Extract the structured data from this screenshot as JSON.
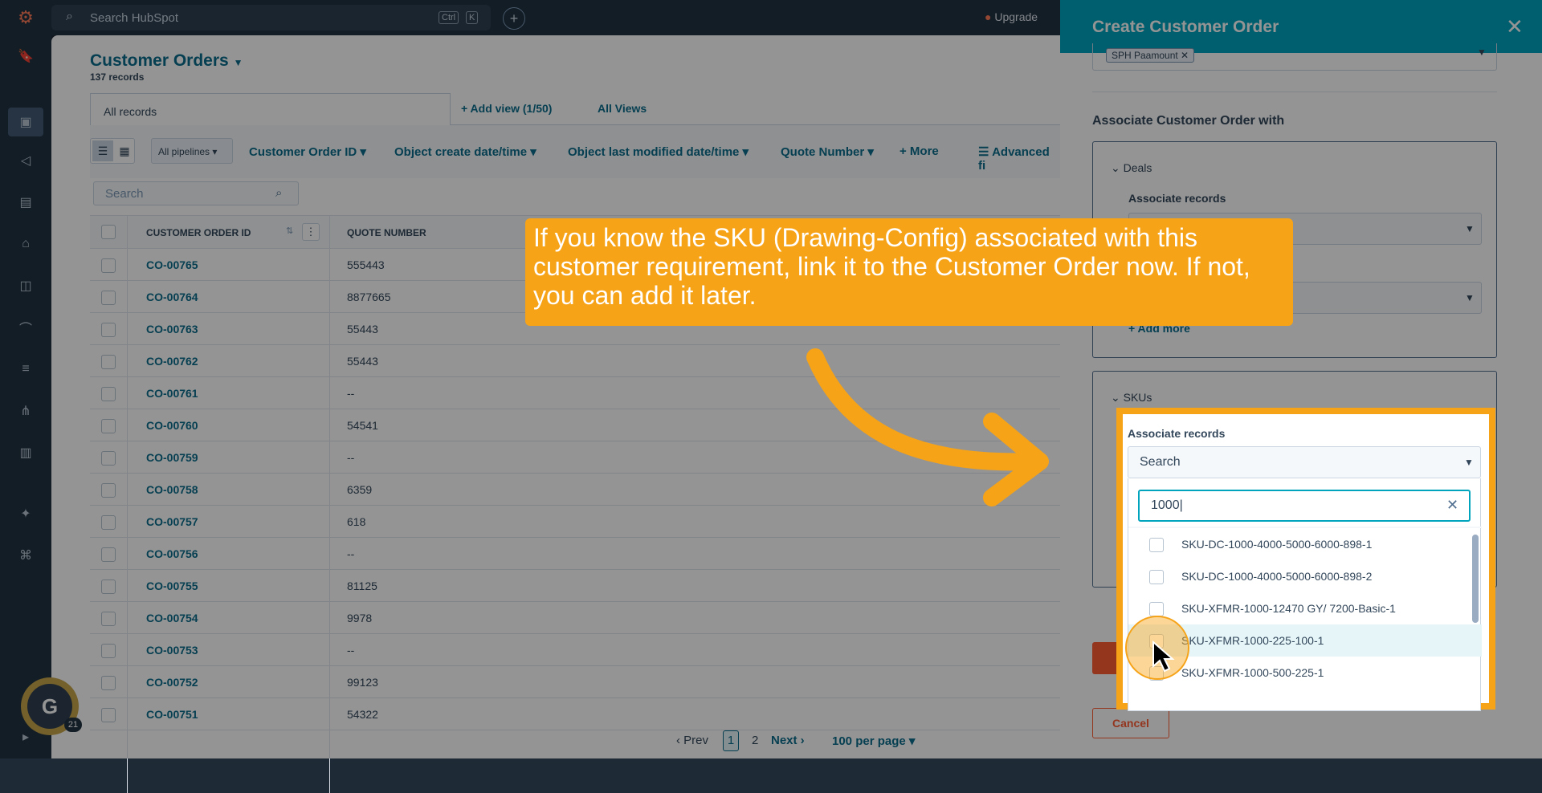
{
  "app": {
    "search_placeholder": "Search HubSpot",
    "shortcut_keys": [
      "Ctrl",
      "K"
    ],
    "upgrade_label": "Upgrade"
  },
  "rail_icons": [
    "hubspot-logo-icon",
    "bookmark-icon",
    "contacts-icon",
    "megaphone-icon",
    "content-icon",
    "commerce-icon",
    "service-icon",
    "help-desk-icon",
    "database-icon",
    "workflows-icon",
    "reports-icon",
    "ai-sparkle-icon",
    "dev-tools-icon",
    "expand-icon"
  ],
  "main": {
    "title": "Customer Orders",
    "record_count": "137 records",
    "view_tab": "All records",
    "add_view": "+ Add view (1/50)",
    "all_views": "All Views",
    "pipeline_filter": "All pipelines",
    "filters": [
      "Customer Order ID",
      "Object create date/time",
      "Object last modified date/time",
      "Quote Number",
      "+ More",
      "Advanced fi"
    ],
    "search_placeholder": "Search",
    "columns": [
      "CUSTOMER ORDER ID",
      "QUOTE NUMBER"
    ],
    "rows": [
      {
        "id": "CO-00765",
        "quote": "555443"
      },
      {
        "id": "CO-00764",
        "quote": "8877665"
      },
      {
        "id": "CO-00763",
        "quote": "55443"
      },
      {
        "id": "CO-00762",
        "quote": "55443"
      },
      {
        "id": "CO-00761",
        "quote": "--"
      },
      {
        "id": "CO-00760",
        "quote": "54541"
      },
      {
        "id": "CO-00759",
        "quote": "--"
      },
      {
        "id": "CO-00758",
        "quote": "6359"
      },
      {
        "id": "CO-00757",
        "quote": "618"
      },
      {
        "id": "CO-00756",
        "quote": "--"
      },
      {
        "id": "CO-00755",
        "quote": "81125"
      },
      {
        "id": "CO-00754",
        "quote": "9978"
      },
      {
        "id": "CO-00753",
        "quote": "--"
      },
      {
        "id": "CO-00752",
        "quote": "99123"
      },
      {
        "id": "CO-00751",
        "quote": "54322"
      }
    ],
    "pager": {
      "prev": "Prev",
      "page1": "1",
      "page2": "2",
      "next": "Next",
      "per_page": "100 per page"
    }
  },
  "drawer": {
    "title": "Create Customer Order",
    "chip": "SPH Paamount",
    "associate_heading": "Associate Customer Order with",
    "deals_label": "Deals",
    "associate_records": "Associate records",
    "add_more": "+ Add more",
    "skus_label": "SKUs",
    "cancel": "Cancel"
  },
  "overlay": {
    "callout": "If you know the SKU (Drawing-Config) associated with this customer requirement, link it to the Customer Order now. If not, you can add it later.",
    "dropdown_label": "Associate records",
    "dropdown_value": "Search",
    "search_value": "1000",
    "options": [
      "SKU-DC-1000-4000-5000-6000-898-1",
      "SKU-DC-1000-4000-5000-6000-898-2",
      "SKU-XFMR-1000-12470 GY/ 7200-Basic-1",
      "SKU-XFMR-1000-225-100-1",
      "SKU-XFMR-1000-500-225-1"
    ],
    "highlighted_index": 3
  },
  "badge_count": "21"
}
